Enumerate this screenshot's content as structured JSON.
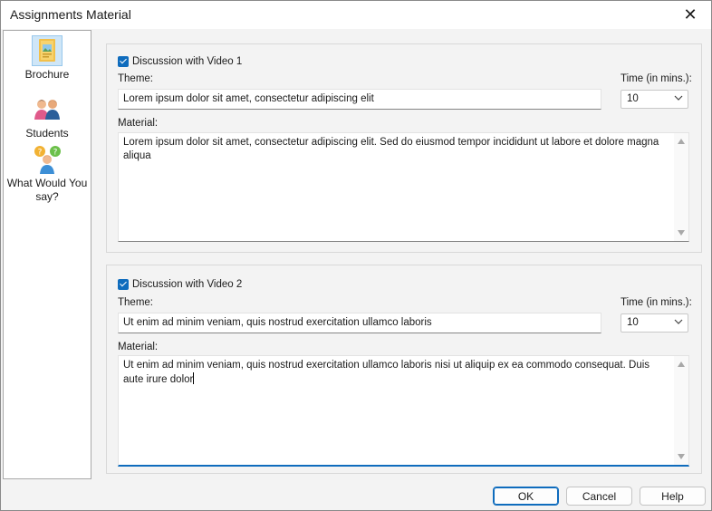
{
  "window": {
    "title": "Assignments Material",
    "close_glyph": "✕"
  },
  "sidebar": {
    "items": [
      {
        "label": "Brochure",
        "icon": "brochure-icon",
        "selected": true
      },
      {
        "label": "Students",
        "icon": "students-icon",
        "selected": false
      },
      {
        "label": "What Would You say?",
        "icon": "question-person-icon",
        "selected": false
      }
    ]
  },
  "sections": [
    {
      "checkbox_label": "Discussion with Video 1",
      "checked": true,
      "theme_label": "Theme:",
      "theme_value": "Lorem ipsum dolor sit amet, consectetur adipiscing elit",
      "time_label": "Time (in mins.):",
      "time_value": "10",
      "material_label": "Material:",
      "material_value": "Lorem ipsum dolor sit amet, consectetur adipiscing elit. Sed do eiusmod tempor incididunt ut labore et dolore magna aliqua"
    },
    {
      "checkbox_label": "Discussion with Video 2",
      "checked": true,
      "theme_label": "Theme:",
      "theme_value": "Ut enim ad minim veniam, quis nostrud exercitation ullamco laboris",
      "time_label": "Time (in mins.):",
      "time_value": "10",
      "material_label": "Material:",
      "material_value": "Ut enim ad minim veniam, quis nostrud exercitation ullamco laboris nisi ut aliquip ex ea commodo consequat. Duis aute irure dolor"
    }
  ],
  "footer": {
    "ok_label": "OK",
    "cancel_label": "Cancel",
    "help_label": "Help"
  },
  "colors": {
    "accent": "#0f6cbd",
    "selected_bg": "#cfe6f7"
  }
}
